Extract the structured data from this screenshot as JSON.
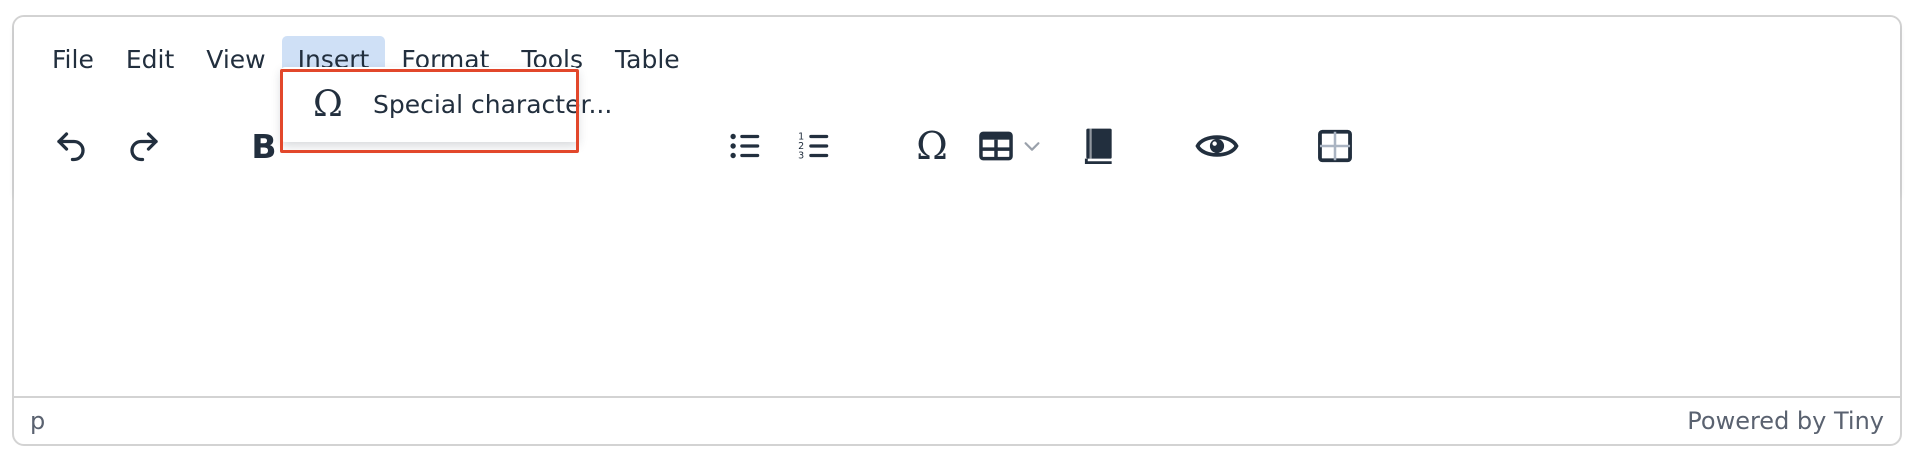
{
  "menubar": {
    "items": [
      {
        "label": "File"
      },
      {
        "label": "Edit"
      },
      {
        "label": "View"
      },
      {
        "label": "Insert",
        "active": true
      },
      {
        "label": "Format"
      },
      {
        "label": "Tools"
      },
      {
        "label": "Table"
      }
    ]
  },
  "toolbar": {
    "buttons": [
      {
        "name": "undo",
        "icon": "undo-icon"
      },
      {
        "name": "redo",
        "icon": "redo-icon"
      },
      {
        "name": "bold",
        "icon": "bold-icon",
        "label": "B"
      },
      {
        "name": "bullet-list",
        "icon": "bullet-list-icon"
      },
      {
        "name": "numbered-list",
        "icon": "numbered-list-icon"
      },
      {
        "name": "special-character",
        "icon": "omega-icon"
      },
      {
        "name": "table",
        "icon": "table-icon",
        "has_dropdown": true
      },
      {
        "name": "book",
        "icon": "book-icon"
      },
      {
        "name": "preview",
        "icon": "eye-icon"
      },
      {
        "name": "visual-aid",
        "icon": "grid-icon"
      }
    ]
  },
  "insert_menu": {
    "items": [
      {
        "label": "Special character...",
        "icon": "omega-icon",
        "symbol": "Ω"
      }
    ]
  },
  "statusbar": {
    "path": "p",
    "branding": "Powered by Tiny"
  },
  "colors": {
    "text": "#222f3e",
    "active_menu_bg": "#cfe0f6",
    "highlight_border": "#e2472b",
    "border": "#d3d3d3"
  }
}
